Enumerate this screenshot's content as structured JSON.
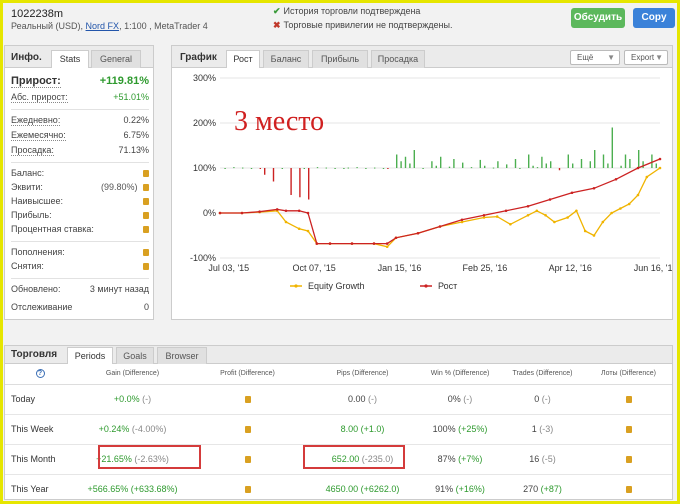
{
  "header": {
    "account_id": "1022238m",
    "account_type": "Реальный (USD),",
    "broker": "Nord FX",
    "leverage_platform": ", 1:100 , MetaTrader 4",
    "history_status": "История торговли подтверждена",
    "privileges_status": "Торговые привилегии не подтверждены.",
    "discuss_label": "Обсудить",
    "copy_label": "Copy"
  },
  "info": {
    "title": "Инфо.",
    "tabs": [
      "Stats",
      "General"
    ],
    "gain_label": "Прирост:",
    "gain_value": "+119.81%",
    "abs_gain_label": "Абс. прирост:",
    "abs_gain_value": "+51.01%",
    "daily_label": "Ежедневно:",
    "daily_value": "0.22%",
    "monthly_label": "Ежемесячно:",
    "monthly_value": "6.75%",
    "drawdown_label": "Просадка:",
    "drawdown_value": "71.13%",
    "balance_label": "Баланс:",
    "equity_label": "Эквити:",
    "equity_pct": "(99.80%)",
    "highest_label": "Наивысшее:",
    "profit_label": "Прибыль:",
    "interest_label": "Процентная ставка:",
    "deposits_label": "Пополнения:",
    "withdrawals_label": "Снятия:",
    "updated_label": "Обновлено:",
    "updated_value": "3 минут назад",
    "tracking_label": "Отслеживание",
    "tracking_value": "0"
  },
  "chart_panel": {
    "title": "График",
    "tabs": [
      "Рост",
      "Баланс",
      "Прибыль",
      "Просадка"
    ],
    "more_label": "Ещё",
    "export_label": "Export",
    "overlay_text": "3 место"
  },
  "chart_data": {
    "type": "line",
    "y_ticks": [
      "300%",
      "200%",
      "100%",
      "0%",
      "-100%"
    ],
    "x_ticks": [
      "Jul 03, '15",
      "Oct 07, '15",
      "Jan 15, '16",
      "Feb 25, '16",
      "Apr 12, '16",
      "Jun 16, '16"
    ],
    "ylim": [
      -100,
      300
    ],
    "series": [
      {
        "name": "Equity Growth",
        "color": "#f0b400",
        "x": [
          0,
          0.05,
          0.09,
          0.13,
          0.15,
          0.18,
          0.2,
          0.22,
          0.25,
          0.3,
          0.35,
          0.38,
          0.4,
          0.45,
          0.5,
          0.55,
          0.6,
          0.63,
          0.66,
          0.7,
          0.72,
          0.74,
          0.76,
          0.79,
          0.81,
          0.83,
          0.85,
          0.87,
          0.89,
          0.91,
          0.93,
          0.95,
          0.97,
          1.0
        ],
        "y": [
          0,
          0,
          2,
          5,
          -20,
          -35,
          -40,
          -68,
          -68,
          -68,
          -68,
          -75,
          -55,
          -45,
          -30,
          -20,
          -10,
          -8,
          -25,
          -5,
          5,
          -5,
          -20,
          -10,
          5,
          -40,
          -50,
          -20,
          0,
          10,
          20,
          40,
          80,
          100
        ]
      },
      {
        "name": "Рост",
        "color": "#cc2222",
        "x": [
          0,
          0.05,
          0.09,
          0.13,
          0.15,
          0.18,
          0.2,
          0.22,
          0.25,
          0.3,
          0.35,
          0.38,
          0.4,
          0.45,
          0.5,
          0.55,
          0.6,
          0.65,
          0.7,
          0.75,
          0.8,
          0.85,
          0.9,
          0.95,
          1.0
        ],
        "y": [
          0,
          0,
          3,
          8,
          5,
          5,
          0,
          -68,
          -68,
          -68,
          -68,
          -68,
          -55,
          -45,
          -30,
          -15,
          -5,
          5,
          15,
          30,
          45,
          55,
          75,
          100,
          120
        ]
      }
    ],
    "bars": {
      "positive_color": "#4caf50",
      "negative_color": "#cc2222",
      "x": [
        0.01,
        0.03,
        0.05,
        0.07,
        0.09,
        0.1,
        0.12,
        0.14,
        0.16,
        0.18,
        0.19,
        0.2,
        0.22,
        0.24,
        0.26,
        0.28,
        0.29,
        0.31,
        0.33,
        0.35,
        0.37,
        0.38,
        0.4,
        0.41,
        0.42,
        0.43,
        0.44,
        0.46,
        0.48,
        0.49,
        0.5,
        0.52,
        0.53,
        0.55,
        0.57,
        0.59,
        0.6,
        0.62,
        0.63,
        0.65,
        0.67,
        0.68,
        0.7,
        0.71,
        0.72,
        0.73,
        0.74,
        0.75,
        0.77,
        0.79,
        0.8,
        0.82,
        0.84,
        0.85,
        0.87,
        0.88,
        0.89,
        0.91,
        0.92,
        0.93,
        0.95,
        0.96,
        0.98,
        0.99
      ],
      "y": [
        100,
        102,
        101,
        100,
        99,
        85,
        70,
        100,
        40,
        35,
        100,
        30,
        102,
        101,
        100,
        100,
        101,
        102,
        100,
        101,
        100,
        98,
        130,
        115,
        125,
        110,
        140,
        100,
        115,
        105,
        125,
        103,
        120,
        112,
        102,
        118,
        105,
        101,
        115,
        108,
        120,
        100,
        130,
        105,
        102,
        125,
        110,
        115,
        95,
        130,
        110,
        120,
        115,
        140,
        130,
        110,
        190,
        105,
        130,
        120,
        140,
        115,
        130,
        110
      ]
    }
  },
  "trading": {
    "title": "Торговля",
    "tabs": [
      "Periods",
      "Goals",
      "Browser"
    ],
    "columns": [
      "Gain (Difference)",
      "Profit (Difference)",
      "Pips (Difference)",
      "Win % (Difference)",
      "Trades (Difference)",
      "Лоты (Difference)"
    ],
    "rows": [
      {
        "period": "Today",
        "gain": "+0.0%",
        "gain_diff": "(-)",
        "pips": "0.00",
        "pips_diff": "(-)",
        "win": "0%",
        "win_diff": "(-)",
        "trades": "0",
        "trades_diff": "(-)"
      },
      {
        "period": "This Week",
        "gain": "+0.24%",
        "gain_diff": "(-4.00%)",
        "pips": "8.00",
        "pips_diff": "(+1.0)",
        "win": "100%",
        "win_diff": "(+25%)",
        "trades": "1",
        "trades_diff": "(-3)"
      },
      {
        "period": "This Month",
        "gain": "+21.65%",
        "gain_diff": "(-2.63%)",
        "pips": "652.00",
        "pips_diff": "(-235.0)",
        "win": "87%",
        "win_diff": "(+7%)",
        "trades": "16",
        "trades_diff": "(-5)"
      },
      {
        "period": "This Year",
        "gain": "+566.65%",
        "gain_diff": "(+633.68%)",
        "pips": "4650.00",
        "pips_diff": "(+6262.0)",
        "win": "91%",
        "win_diff": "(+16%)",
        "trades": "270",
        "trades_diff": "(+87)"
      }
    ]
  }
}
